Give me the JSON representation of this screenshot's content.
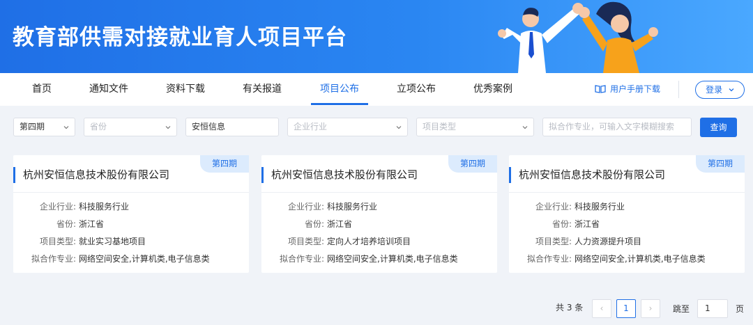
{
  "banner": {
    "title": "教育部供需对接就业育人项目平台"
  },
  "nav": {
    "items": [
      {
        "label": "首页"
      },
      {
        "label": "通知文件"
      },
      {
        "label": "资料下载"
      },
      {
        "label": "有关报道"
      },
      {
        "label": "项目公布",
        "active": true
      },
      {
        "label": "立项公布"
      },
      {
        "label": "优秀案例"
      }
    ],
    "manual_label": "用户手册下载",
    "login_label": "登录"
  },
  "filters": {
    "phase": "第四期",
    "province_placeholder": "省份",
    "company": "安恒信息",
    "industry_placeholder": "企业行业",
    "project_type_placeholder": "项目类型",
    "major_placeholder": "拟合作专业，可输入文字模糊搜索",
    "search_label": "查询"
  },
  "field_labels": {
    "industry": "企业行业:",
    "province": "省份:",
    "project_type": "项目类型:",
    "major": "拟合作专业:"
  },
  "cards": [
    {
      "phase": "第四期",
      "company": "杭州安恒信息技术股份有限公司",
      "industry": "科技服务行业",
      "province": "浙江省",
      "project_type": "就业实习基地项目",
      "major": "网络空间安全,计算机类,电子信息类"
    },
    {
      "phase": "第四期",
      "company": "杭州安恒信息技术股份有限公司",
      "industry": "科技服务行业",
      "province": "浙江省",
      "project_type": "定向人才培养培训项目",
      "major": "网络空间安全,计算机类,电子信息类"
    },
    {
      "phase": "第四期",
      "company": "杭州安恒信息技术股份有限公司",
      "industry": "科技服务行业",
      "province": "浙江省",
      "project_type": "人力资源提升项目",
      "major": "网络空间安全,计算机类,电子信息类"
    }
  ],
  "pagination": {
    "total": "共 3 条",
    "prev": "‹",
    "current": "1",
    "next": "›",
    "jump_label": "跳至",
    "jump_value": "1",
    "unit": "页"
  },
  "colors": {
    "accent": "#1f6fe6",
    "background": "#f0f3f8"
  }
}
